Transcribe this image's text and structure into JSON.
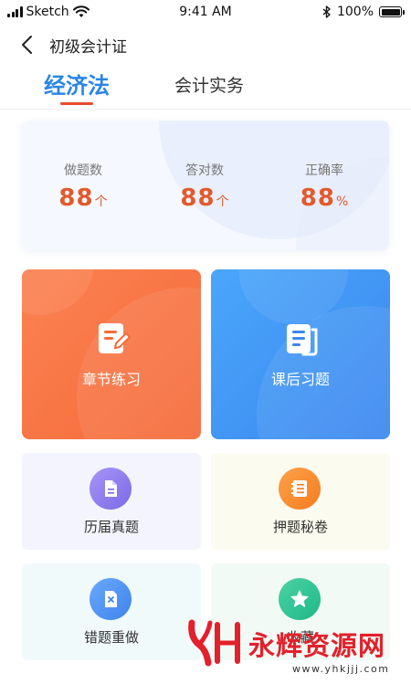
{
  "status_bar": {
    "carrier": "Sketch",
    "time": "9:41 AM",
    "battery": "100%"
  },
  "nav": {
    "title": "初级会计证"
  },
  "tabs": [
    {
      "label": "经济法",
      "active": true
    },
    {
      "label": "会计实务",
      "active": false
    }
  ],
  "stats": [
    {
      "label": "做题数",
      "value": "88",
      "unit": "个"
    },
    {
      "label": "答对数",
      "value": "88",
      "unit": "个"
    },
    {
      "label": "正确率",
      "value": "88",
      "unit": "%"
    }
  ],
  "big_cards": [
    {
      "label": "章节练习",
      "icon": "edit-note-icon",
      "color": "#f56a38"
    },
    {
      "label": "课后习题",
      "icon": "document-list-icon",
      "color": "#3b87ee"
    }
  ],
  "small_cards": [
    {
      "label": "历届真题",
      "icon": "file-icon",
      "color": "#7b69e6"
    },
    {
      "label": "押题秘卷",
      "icon": "notebook-list-icon",
      "color": "#f67c1f"
    },
    {
      "label": "错题重做",
      "icon": "error-file-icon",
      "color": "#3f84ee"
    },
    {
      "label": "收藏",
      "icon": "star-icon",
      "color": "#1fb787"
    }
  ],
  "watermark": {
    "text": "永辉资源网",
    "url": "www.yhkjjj.com"
  }
}
